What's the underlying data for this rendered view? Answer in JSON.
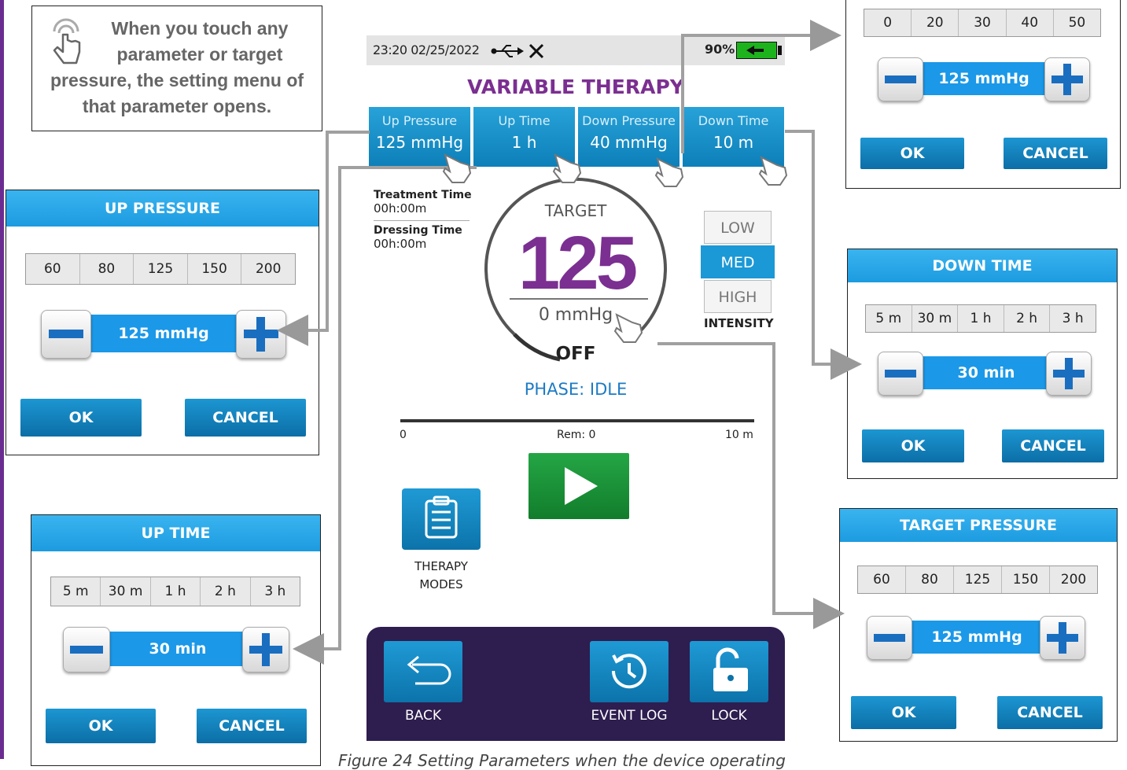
{
  "note": {
    "text_lines": [
      "When you touch any",
      "parameter or target",
      "pressure, the setting menu of",
      "that parameter opens."
    ]
  },
  "status_bar": {
    "datetime": "23:20 02/25/2022",
    "battery": "90%"
  },
  "screen_title": "VARIABLE THERAPY",
  "params": [
    {
      "label": "Up Pressure",
      "value": "125 mmHg"
    },
    {
      "label": "Up Time",
      "value": "1 h"
    },
    {
      "label": "Down Pressure",
      "value": "40 mmHg"
    },
    {
      "label": "Down Time",
      "value": "10 m"
    }
  ],
  "treatment_time": {
    "label": "Treatment Time",
    "value": "00h:00m"
  },
  "dressing_time": {
    "label": "Dressing Time",
    "value": "00h:00m"
  },
  "gauge": {
    "target_label": "TARGET",
    "target_value": "125",
    "pressure": "0 mmHg",
    "state": "OFF",
    "phase": "PHASE: IDLE"
  },
  "intensity": {
    "options": [
      "LOW",
      "MED",
      "HIGH"
    ],
    "selected": "MED",
    "caption": "INTENSITY"
  },
  "progress": {
    "start": "0",
    "remaining": "Rem: 0",
    "end": "10 m"
  },
  "therapy_modes": {
    "label_1": "THERAPY",
    "label_2": "MODES"
  },
  "bottom_nav": {
    "back": "BACK",
    "event_log": "EVENT LOG",
    "lock": "LOCK"
  },
  "popup_down_pressure": {
    "options": [
      "0",
      "20",
      "30",
      "40",
      "50"
    ],
    "value": "125 mmHg",
    "ok": "OK",
    "cancel": "CANCEL"
  },
  "popup_up_pressure": {
    "title": "UP PRESSURE",
    "options": [
      "60",
      "80",
      "125",
      "150",
      "200"
    ],
    "value": "125 mmHg",
    "ok": "OK",
    "cancel": "CANCEL"
  },
  "popup_down_time": {
    "title": "DOWN TIME",
    "options": [
      "5 m",
      "30 m",
      "1 h",
      "2 h",
      "3 h"
    ],
    "value": "30 min",
    "ok": "OK",
    "cancel": "CANCEL"
  },
  "popup_up_time": {
    "title": "UP TIME",
    "options": [
      "5 m",
      "30 m",
      "1 h",
      "2 h",
      "3 h"
    ],
    "value": "30 min",
    "ok": "OK",
    "cancel": "CANCEL"
  },
  "popup_target_pressure": {
    "title": "TARGET PRESSURE",
    "options": [
      "60",
      "80",
      "125",
      "150",
      "200"
    ],
    "value": "125 mmHg",
    "ok": "OK",
    "cancel": "CANCEL"
  },
  "caption": "Figure 24 Setting Parameters when the device operating",
  "colors": {
    "accent_purple": "#7b2f91",
    "accent_blue": "#1b98d6",
    "play_green": "#1e9a3c",
    "nav_bg": "#2e1d4f"
  },
  "icons": [
    "touch-hand-icon",
    "usb-icon",
    "wrench-tools-icon",
    "plug-battery-icon",
    "play-icon",
    "clipboard-icon",
    "back-arrow-icon",
    "history-icon",
    "unlock-icon"
  ]
}
